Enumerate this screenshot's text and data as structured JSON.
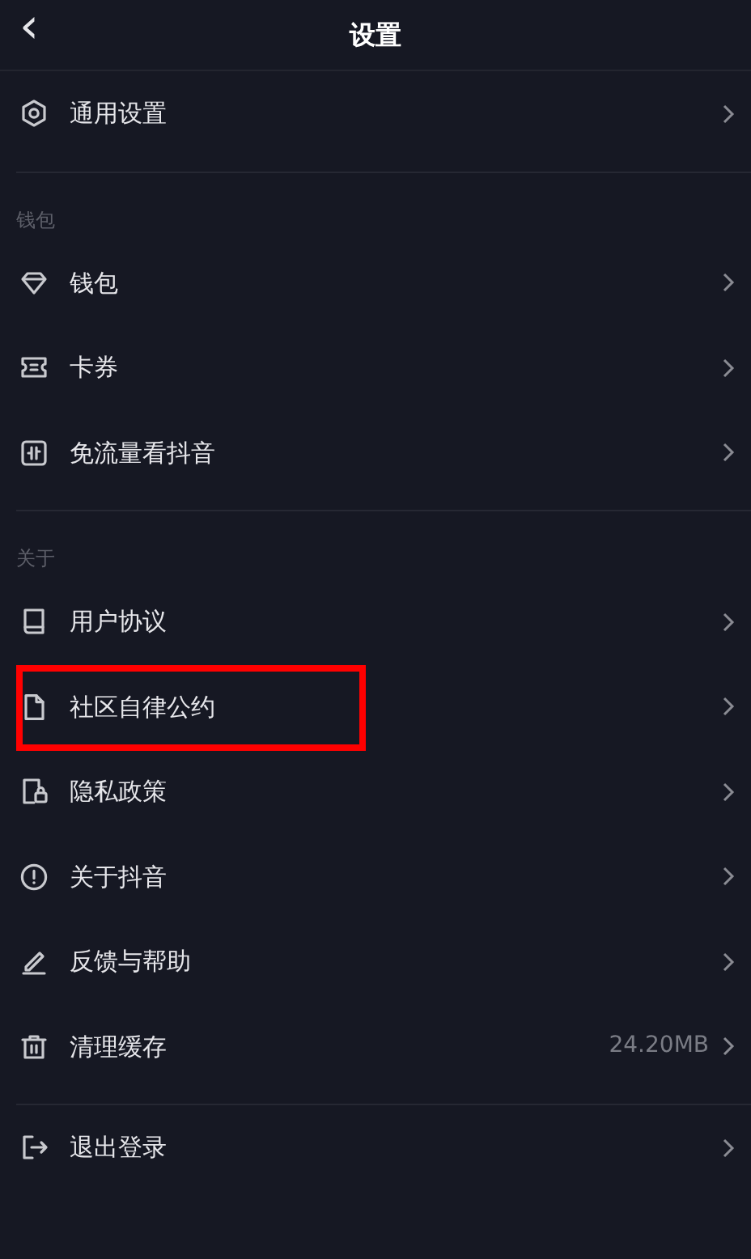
{
  "header": {
    "back": "‹",
    "title": "设置"
  },
  "sections": [
    {
      "items": [
        {
          "label": "通用设置",
          "highlighted": false
        }
      ]
    },
    {
      "label": "钱包",
      "items": [
        {
          "label": "钱包",
          "highlighted": false
        },
        {
          "label": "卡券",
          "highlighted": false
        },
        {
          "label": "免流量看抖音",
          "highlighted": false
        }
      ]
    },
    {
      "label": "关于",
      "items": [
        {
          "label": "用户协议",
          "highlighted": false
        },
        {
          "label": "社区自律公约",
          "highlighted": true
        },
        {
          "label": "隐私政策",
          "highlighted": false
        },
        {
          "label": "关于抖音",
          "highlighted": false
        },
        {
          "label": "反馈与帮助",
          "highlighted": false
        },
        {
          "label": "清理缓存",
          "value": "24.20MB",
          "highlighted": false
        }
      ]
    },
    {
      "items": [
        {
          "label": "退出登录",
          "highlighted": false
        }
      ]
    }
  ]
}
